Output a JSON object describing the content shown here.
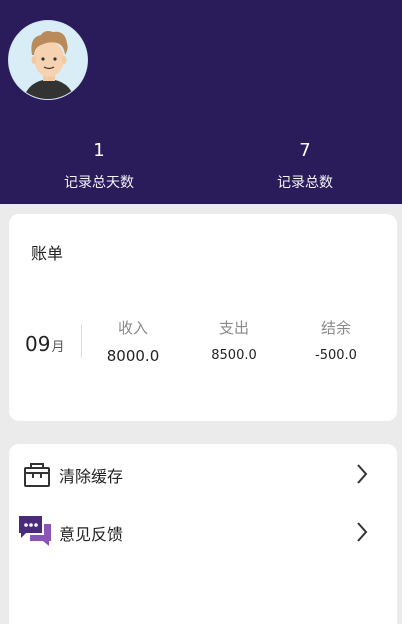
{
  "header": {
    "stats": {
      "days": {
        "value": "1",
        "label": "记录总天数"
      },
      "total": {
        "value": "7",
        "label": "记录总数"
      }
    }
  },
  "bill": {
    "title": "账单",
    "month": "09",
    "month_unit": "月",
    "income": {
      "label": "收入",
      "value": "8000.0"
    },
    "expense": {
      "label": "支出",
      "value": "8500.0"
    },
    "balance": {
      "label": "结余",
      "value": "-500.0"
    }
  },
  "menu": {
    "items": [
      {
        "label": "清除缓存",
        "icon": "cache-box-icon"
      },
      {
        "label": "意见反馈",
        "icon": "feedback-chat-icon"
      }
    ]
  },
  "colors": {
    "header_bg": "#2a1c5b",
    "feedback_icon": "#5b2c86"
  }
}
